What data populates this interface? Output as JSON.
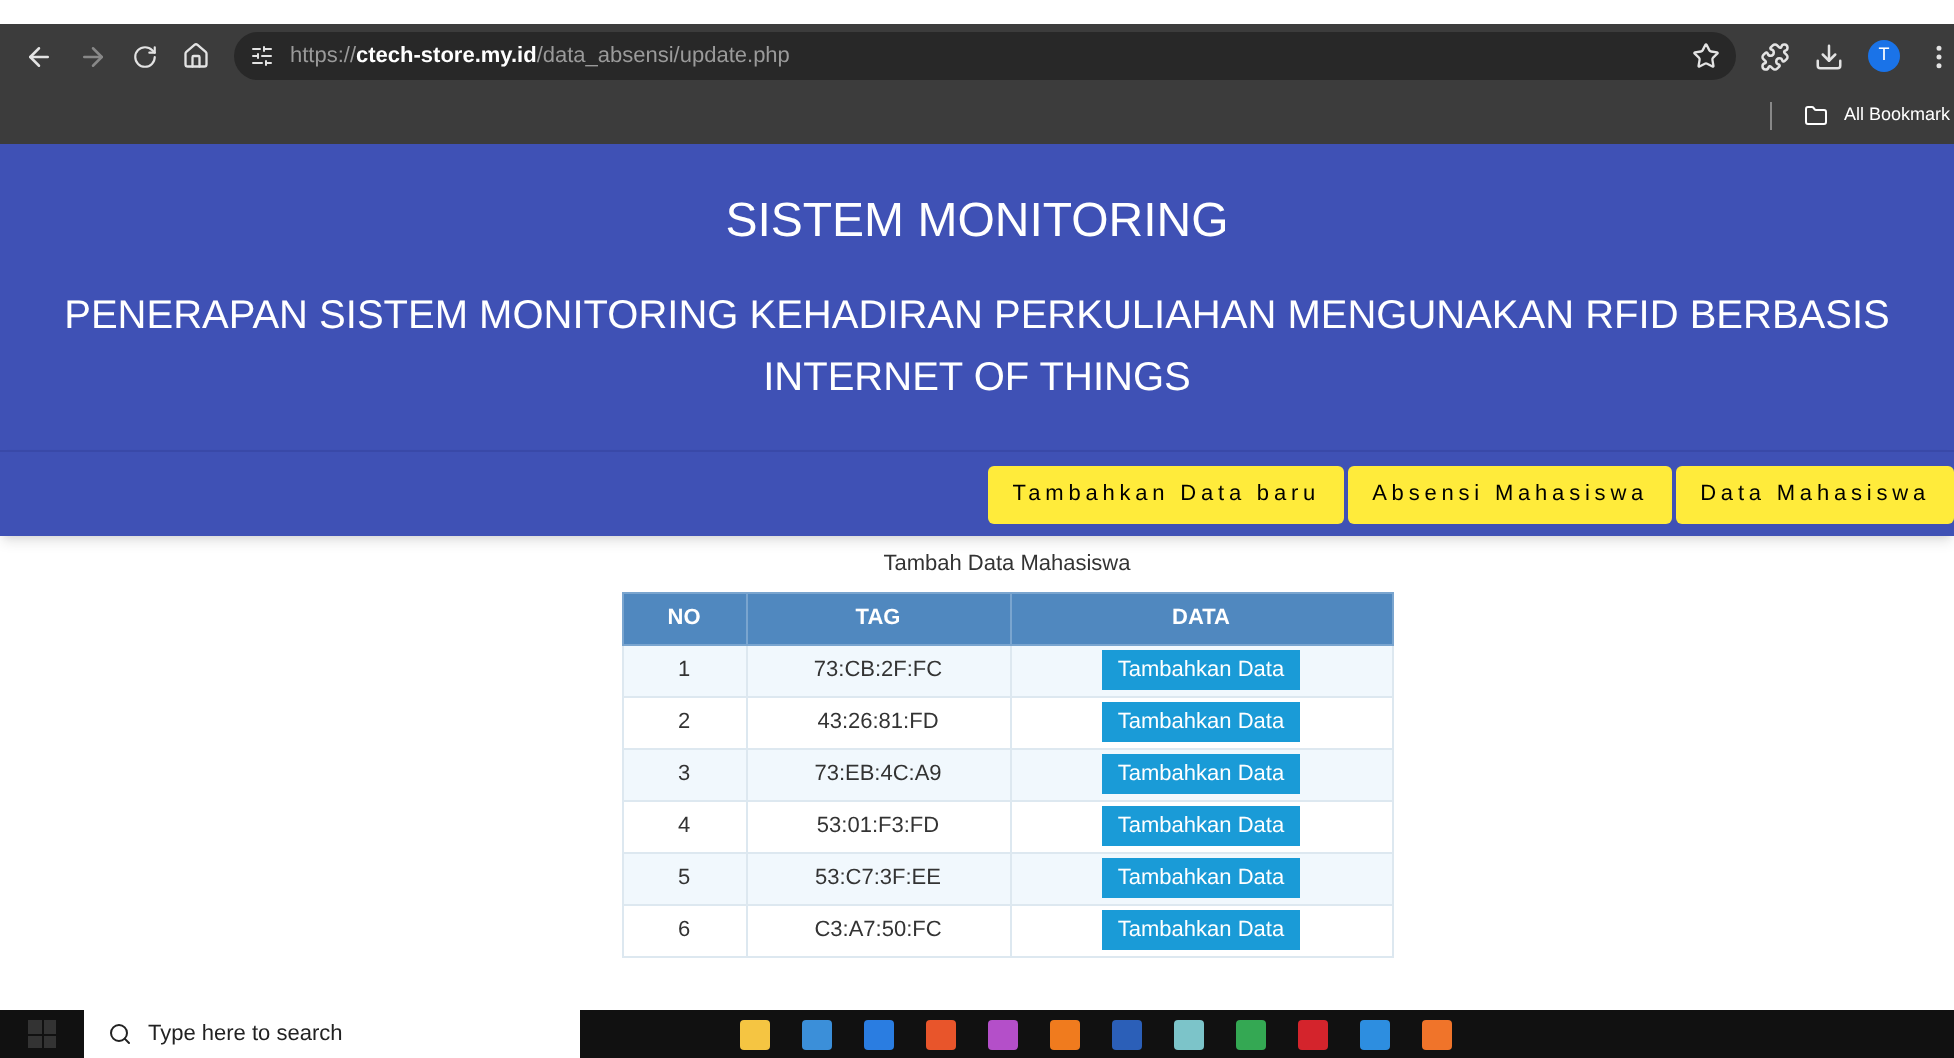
{
  "browser": {
    "url_host": "https://",
    "url_domain": "ctech-store.my.id",
    "url_path": "/data_absensi/update.php",
    "bookmarks": "All Bookmark",
    "profile": "T"
  },
  "header": {
    "title": "SISTEM MONITORING",
    "subtitle": "PENERAPAN SISTEM MONITORING KEHADIRAN PERKULIAHAN MENGUNAKAN RFID BERBASIS INTERNET OF THINGS"
  },
  "nav": [
    {
      "label": "Tambahkan Data baru"
    },
    {
      "label": "Absensi Mahasiswa"
    },
    {
      "label": "Data Mahasiswa"
    }
  ],
  "table": {
    "caption": "Tambah Data Mahasiswa",
    "columns": [
      "NO",
      "TAG",
      "DATA"
    ],
    "rows": [
      {
        "no": "1",
        "tag": "73:CB:2F:FC",
        "action": "Tambahkan Data"
      },
      {
        "no": "2",
        "tag": "43:26:81:FD",
        "action": "Tambahkan Data"
      },
      {
        "no": "3",
        "tag": "73:EB:4C:A9",
        "action": "Tambahkan Data"
      },
      {
        "no": "4",
        "tag": "53:01:F3:FD",
        "action": "Tambahkan Data"
      },
      {
        "no": "5",
        "tag": "53:C7:3F:EE",
        "action": "Tambahkan Data"
      },
      {
        "no": "6",
        "tag": "C3:A7:50:FC",
        "action": "Tambahkan Data"
      }
    ]
  },
  "taskbar": {
    "search_placeholder": "Type here to search"
  }
}
